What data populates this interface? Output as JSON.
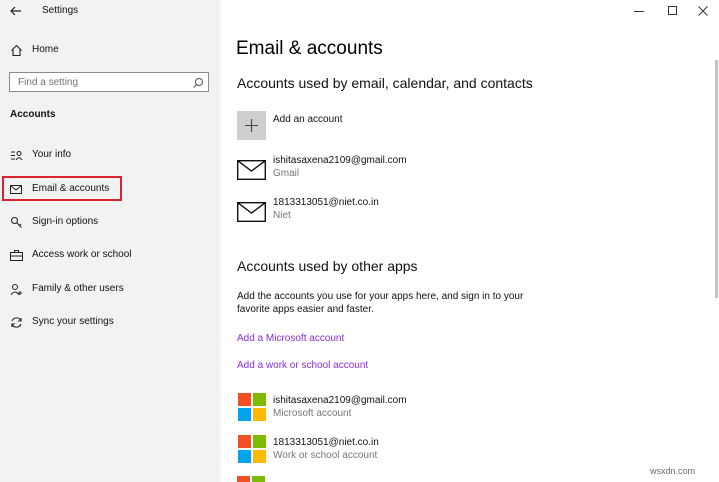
{
  "window": {
    "app_title": "Settings"
  },
  "sidebar": {
    "home_label": "Home",
    "search_placeholder": "Find a setting",
    "section_label": "Accounts",
    "items": [
      {
        "label": "Your info",
        "icon": "person-card-icon"
      },
      {
        "label": "Email & accounts",
        "icon": "mail-icon",
        "selected": true
      },
      {
        "label": "Sign-in options",
        "icon": "key-icon"
      },
      {
        "label": "Access work or school",
        "icon": "briefcase-icon"
      },
      {
        "label": "Family & other users",
        "icon": "person-add-icon"
      },
      {
        "label": "Sync your settings",
        "icon": "sync-icon"
      }
    ]
  },
  "main": {
    "title": "Email & accounts",
    "email_section": {
      "heading": "Accounts used by email, calendar, and contacts",
      "add_label": "Add an account",
      "accounts": [
        {
          "email": "ishitasaxena2109@gmail.com",
          "type": "Gmail"
        },
        {
          "email": "1813313051@niet.co.in",
          "type": "Niet"
        }
      ]
    },
    "apps_section": {
      "heading": "Accounts used by other apps",
      "description": "Add the accounts you use for your apps here, and sign in to your favorite apps easier and faster.",
      "link_microsoft": "Add a Microsoft account",
      "link_work": "Add a work or school account",
      "accounts": [
        {
          "email": "ishitasaxena2109@gmail.com",
          "type": "Microsoft account"
        },
        {
          "email": "1813313051@niet.co.in",
          "type": "Work or school account"
        }
      ]
    }
  },
  "colors": {
    "link": "#8a2be2",
    "selection_outline": "#d9232d",
    "sidebar_bg": "#f2f2f2",
    "ms_red": "#f25022",
    "ms_green": "#7fba00",
    "ms_blue": "#00a4ef",
    "ms_yellow": "#ffb900"
  },
  "watermark": "wsxdn.com"
}
